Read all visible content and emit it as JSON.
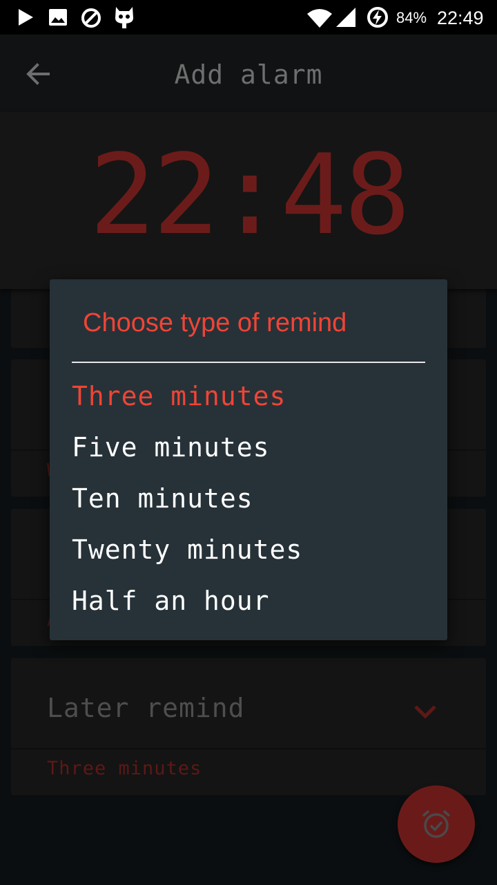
{
  "status_bar": {
    "battery_percent": "84%",
    "time": "22:49",
    "icons": [
      "play-icon",
      "image-icon",
      "do-not-disturb-icon",
      "cyanogen-icon",
      "wifi-icon",
      "cell-signal-icon",
      "battery-charging-icon"
    ]
  },
  "app_bar": {
    "title": "Add alarm",
    "back_icon": "arrow-back-icon"
  },
  "time_header": {
    "time": "22:48"
  },
  "dialog": {
    "title": "Choose type of remind",
    "options": [
      {
        "label": "Three minutes",
        "selected": true
      },
      {
        "label": "Five minutes",
        "selected": false
      },
      {
        "label": "Ten minutes",
        "selected": false
      },
      {
        "label": "Twenty minutes",
        "selected": false
      },
      {
        "label": "Half an hour",
        "selected": false
      }
    ]
  },
  "later_remind_card": {
    "label": "Later remind",
    "value": "Three minutes",
    "icon": "chevron-down-icon"
  },
  "fab": {
    "icon": "alarm-check-icon"
  },
  "colors": {
    "accent": "#f04436",
    "dialog_bg": "#263238",
    "time_text": "#6b1c1a"
  }
}
